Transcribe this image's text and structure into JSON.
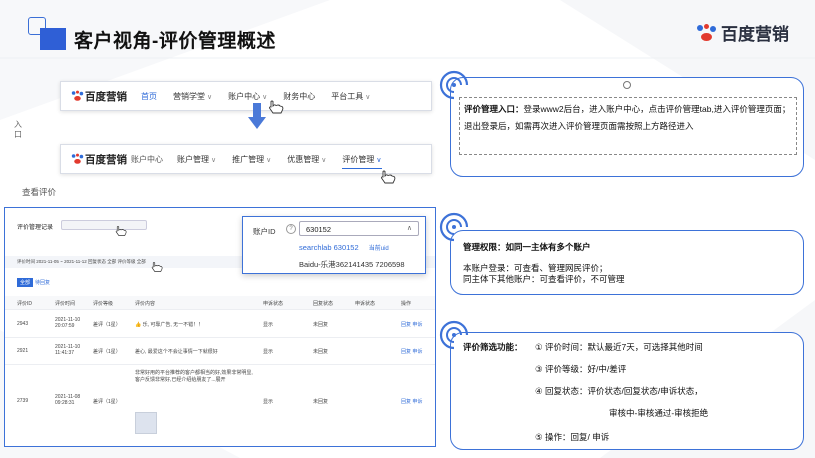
{
  "slide": {
    "title": "客户视角-评价管理概述",
    "brand": "百度营销",
    "side_label_entry": "入口",
    "side_label_view": "查看评价"
  },
  "nav_top": {
    "logo": "百度营销",
    "items": [
      "首页",
      "营销学堂",
      "账户中心",
      "财务中心",
      "平台工具"
    ],
    "active_index": 0
  },
  "nav_account": {
    "logo": "百度营销",
    "suffix": "账户中心",
    "items": [
      "账户管理",
      "推广管理",
      "优惠管理",
      "评价管理"
    ],
    "active_index": 3
  },
  "eval_table": {
    "title": "评价管理记录",
    "account_label": "账户ID",
    "filters_line": "评价时间 2021-11-05 ~ 2021-11-12  回复状态 全部  评价等级 全部",
    "tabs": [
      "全部",
      "待回复"
    ],
    "columns": [
      "评价ID",
      "评价时间",
      "评价等级",
      "评价内容",
      "申诉状态",
      "回复状态",
      "申诉状态",
      "操作"
    ],
    "rows": [
      {
        "id": "2943",
        "time": "2021-11-10 20:07:59",
        "level": "差评（1星）",
        "content": "👍 乐, 可靠广告, 无一不错！！",
        "s1": "显示",
        "s2": "未回复",
        "op": "回复 申诉"
      },
      {
        "id": "2921",
        "time": "2021-11-10 11:41:37",
        "level": "差评（1星）",
        "content": "差心, 最爱这个不会让事情一下就很好",
        "s1": "显示",
        "s2": "未回复",
        "op": "回复 申诉"
      },
      {
        "id": "2739",
        "time": "2021-11-08 09:28:31",
        "level": "差评（1星）",
        "content": "非常好用的平台推荐的客户都相当的好,效果非常明显,客户反馈非常好,已经介绍给朋友了...展开",
        "s1": "显示",
        "s2": "未回复",
        "op": "回复 申诉"
      }
    ]
  },
  "account_dropdown": {
    "label": "账户ID",
    "value": "630152",
    "options": [
      {
        "name": "searchlab 630152",
        "tag": "当前uid"
      },
      {
        "name": "Baidu-乐港362141435 7206598",
        "tag": ""
      }
    ]
  },
  "callouts": {
    "entry": {
      "heading": "评价管理入口：",
      "text": "登录www2后台，进入账户中心，点击评价管理tab,进入评价管理页面；退出登录后，如需再次进入评价管理页面需按照上方路径进入"
    },
    "permission": {
      "heading": "管理权限：如同一主体有多个账户",
      "line1": "本账户登录：可查看、管理网民评价；",
      "line2": "同主体下其他账户：可查看评价，不可管理"
    },
    "filter": {
      "heading": "评价筛选功能：",
      "items": [
        "① 评价时间：默认最近7天，可选择其他时间",
        "③ 评价等级：好/中/差评",
        "④ 回复状态：评价状态/回复状态/申诉状态，",
        "审核中-审核通过-审核拒绝",
        "⑤ 操作：回复/ 申诉"
      ]
    }
  },
  "colors": {
    "accent": "#2f5fd6",
    "callout_border": "#3d72d8",
    "paw_red": "#e23a2e",
    "paw_blue": "#2f6bd8"
  }
}
